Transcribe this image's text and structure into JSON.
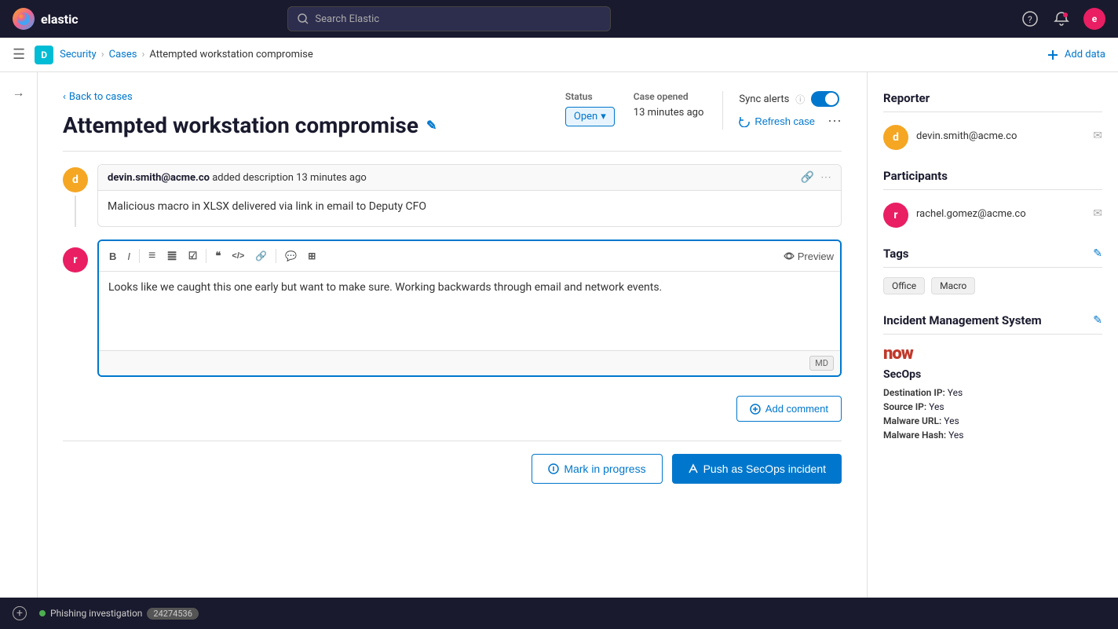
{
  "app": {
    "name": "elastic",
    "logo_letter": "e",
    "avatar_letter": "e"
  },
  "topnav": {
    "search_placeholder": "Search Elastic"
  },
  "breadcrumb": {
    "workspace_label": "D",
    "security": "Security",
    "cases": "Cases",
    "current": "Attempted workstation compromise",
    "add_data": "Add data"
  },
  "case": {
    "back_label": "Back to cases",
    "title": "Attempted workstation compromise",
    "status_label": "Open",
    "status_dropdown_icon": "▾",
    "case_opened_label": "Case opened",
    "case_opened_value": "13 minutes ago",
    "sync_alerts_label": "Sync alerts",
    "sync_info_icon": "ⓘ",
    "sync_enabled": true,
    "refresh_label": "Refresh case",
    "more_icon": "⋯"
  },
  "comments": [
    {
      "avatar": "d",
      "author": "devin.smith@acme.co",
      "action": "added description",
      "time": "13 minutes ago",
      "body": "Malicious macro in XLSX delivered via link in email to Deputy CFO"
    }
  ],
  "editor": {
    "content": "Looks like we caught this one early but want to make sure. Working backwards through email and network events.",
    "preview_label": "Preview",
    "md_label": "MD",
    "toolbar": {
      "bold": "B",
      "italic": "I",
      "unordered_list": "≡",
      "ordered_list": "≣",
      "checkbox": "☑",
      "quote": "❝",
      "code": "</>",
      "link": "🔗",
      "comment_icon": "💬",
      "table_icon": "⊞"
    }
  },
  "actions": {
    "add_comment": "Add comment",
    "mark_in_progress": "Mark in progress",
    "push_secops": "Push as SecOps incident"
  },
  "reporter": {
    "section_title": "Reporter",
    "name": "devin.smith@acme.co",
    "avatar": "d"
  },
  "participants": {
    "section_title": "Participants",
    "list": [
      {
        "avatar": "r",
        "name": "rachel.gomez@acme.co"
      }
    ]
  },
  "tags": {
    "section_title": "Tags",
    "list": [
      "Office",
      "Macro"
    ]
  },
  "ims": {
    "section_title": "Incident Management System",
    "logo": "now",
    "service_name": "SecOps",
    "fields": [
      {
        "label": "Destination IP:",
        "value": "Yes"
      },
      {
        "label": "Source IP:",
        "value": "Yes"
      },
      {
        "label": "Malware URL:",
        "value": "Yes"
      },
      {
        "label": "Malware Hash:",
        "value": "Yes"
      }
    ]
  },
  "statusbar": {
    "tab_label": "Phishing investigation",
    "tab_badge": "24274536",
    "add_tab": "+"
  }
}
